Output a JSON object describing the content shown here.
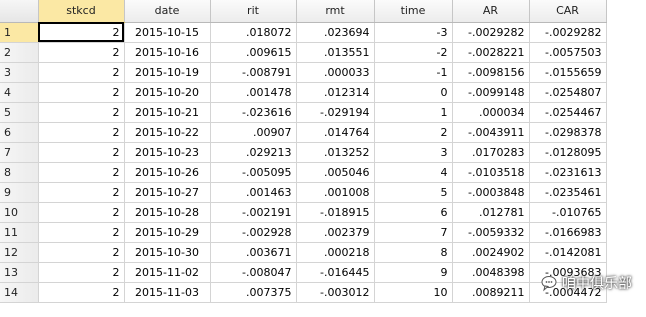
{
  "columns": [
    "stkcd",
    "date",
    "rit",
    "rmt",
    "time",
    "AR",
    "CAR"
  ],
  "rows": [
    {
      "n": "1",
      "stkcd": "2",
      "date": "2015-10-15",
      "rit": ".018072",
      "rmt": ".023694",
      "time": "-3",
      "AR": "-.0029282",
      "CAR": "-.0029282"
    },
    {
      "n": "2",
      "stkcd": "2",
      "date": "2015-10-16",
      "rit": ".009615",
      "rmt": ".013551",
      "time": "-2",
      "AR": "-.0028221",
      "CAR": "-.0057503"
    },
    {
      "n": "3",
      "stkcd": "2",
      "date": "2015-10-19",
      "rit": "-.008791",
      "rmt": ".000033",
      "time": "-1",
      "AR": "-.0098156",
      "CAR": "-.0155659"
    },
    {
      "n": "4",
      "stkcd": "2",
      "date": "2015-10-20",
      "rit": ".001478",
      "rmt": ".012314",
      "time": "0",
      "AR": "-.0099148",
      "CAR": "-.0254807"
    },
    {
      "n": "5",
      "stkcd": "2",
      "date": "2015-10-21",
      "rit": "-.023616",
      "rmt": "-.029194",
      "time": "1",
      "AR": ".000034",
      "CAR": "-.0254467"
    },
    {
      "n": "6",
      "stkcd": "2",
      "date": "2015-10-22",
      "rit": ".00907",
      "rmt": ".014764",
      "time": "2",
      "AR": "-.0043911",
      "CAR": "-.0298378"
    },
    {
      "n": "7",
      "stkcd": "2",
      "date": "2015-10-23",
      "rit": ".029213",
      "rmt": ".013252",
      "time": "3",
      "AR": ".0170283",
      "CAR": "-.0128095"
    },
    {
      "n": "8",
      "stkcd": "2",
      "date": "2015-10-26",
      "rit": "-.005095",
      "rmt": ".005046",
      "time": "4",
      "AR": "-.0103518",
      "CAR": "-.0231613"
    },
    {
      "n": "9",
      "stkcd": "2",
      "date": "2015-10-27",
      "rit": ".001463",
      "rmt": ".001008",
      "time": "5",
      "AR": "-.0003848",
      "CAR": "-.0235461"
    },
    {
      "n": "10",
      "stkcd": "2",
      "date": "2015-10-28",
      "rit": "-.002191",
      "rmt": "-.018915",
      "time": "6",
      "AR": ".012781",
      "CAR": "-.010765"
    },
    {
      "n": "11",
      "stkcd": "2",
      "date": "2015-10-29",
      "rit": "-.002928",
      "rmt": ".002379",
      "time": "7",
      "AR": "-.0059332",
      "CAR": "-.0166983"
    },
    {
      "n": "12",
      "stkcd": "2",
      "date": "2015-10-30",
      "rit": ".003671",
      "rmt": ".000218",
      "time": "8",
      "AR": ".0024902",
      "CAR": "-.0142081"
    },
    {
      "n": "13",
      "stkcd": "2",
      "date": "2015-11-02",
      "rit": "-.008047",
      "rmt": "-.016445",
      "time": "9",
      "AR": ".0048398",
      "CAR": "-.0093683"
    },
    {
      "n": "14",
      "stkcd": "2",
      "date": "2015-11-03",
      "rit": ".007375",
      "rmt": "-.003012",
      "time": "10",
      "AR": ".0089211",
      "CAR": "-.0004472"
    }
  ],
  "selection": {
    "row": "1",
    "column": "stkcd"
  },
  "watermark": {
    "text": "咱中俱乐部",
    "icon": "chat-bubble-icon"
  },
  "colors": {
    "selected_header": "#fbe8a4",
    "grid_line": "#d4d4d4"
  }
}
